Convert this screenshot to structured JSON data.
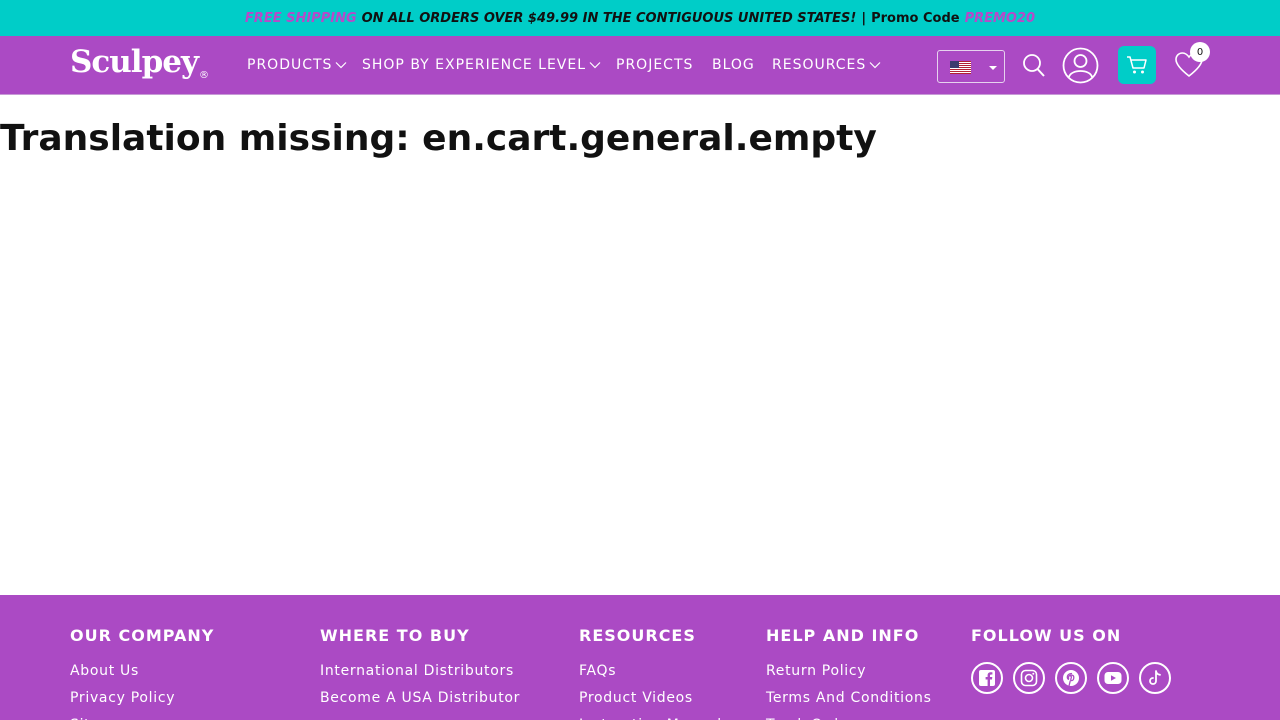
{
  "announcement": {
    "free_shipping": "FREE SHIPPING",
    "offer_text": "ON ALL ORDERS OVER $49.99 IN THE CONTIGUOUS UNITED STATES!",
    "separator": "|",
    "promo_label": "Promo Code",
    "promo_code": "PREMO20"
  },
  "header": {
    "logo_text": "Sculpey",
    "logo_mark": "®",
    "nav": {
      "products": "PRODUCTS",
      "experience": "SHOP BY EXPERIENCE LEVEL",
      "projects": "PROJECTS",
      "blog": "BLOG",
      "resources": "RESOURCES"
    },
    "locale_flag": "us-flag-icon",
    "wishlist_count": "0"
  },
  "main": {
    "title": "Translation missing: en.cart.general.empty"
  },
  "footer": {
    "our_company": {
      "heading": "OUR COMPANY",
      "links": [
        "About Us",
        "Privacy Policy",
        "Sitemap"
      ]
    },
    "where_to_buy": {
      "heading": "WHERE TO BUY",
      "links": [
        "International Distributors",
        "Become A USA Distributor"
      ]
    },
    "resources": {
      "heading": "RESOURCES",
      "links": [
        "FAQs",
        "Product Videos",
        "Instruction Manuals"
      ]
    },
    "help_info": {
      "heading": "HELP AND INFO",
      "links": [
        "Return Policy",
        "Terms And Conditions",
        "Track Order"
      ]
    },
    "follow": {
      "heading": "FOLLOW US ON",
      "icons": [
        "facebook-icon",
        "instagram-icon",
        "pinterest-icon",
        "youtube-icon",
        "tiktok-icon"
      ]
    }
  },
  "colors": {
    "brand_purple": "#ab4ac4",
    "accent_teal": "#00cdc8",
    "promo_pink": "#b64ac9"
  }
}
